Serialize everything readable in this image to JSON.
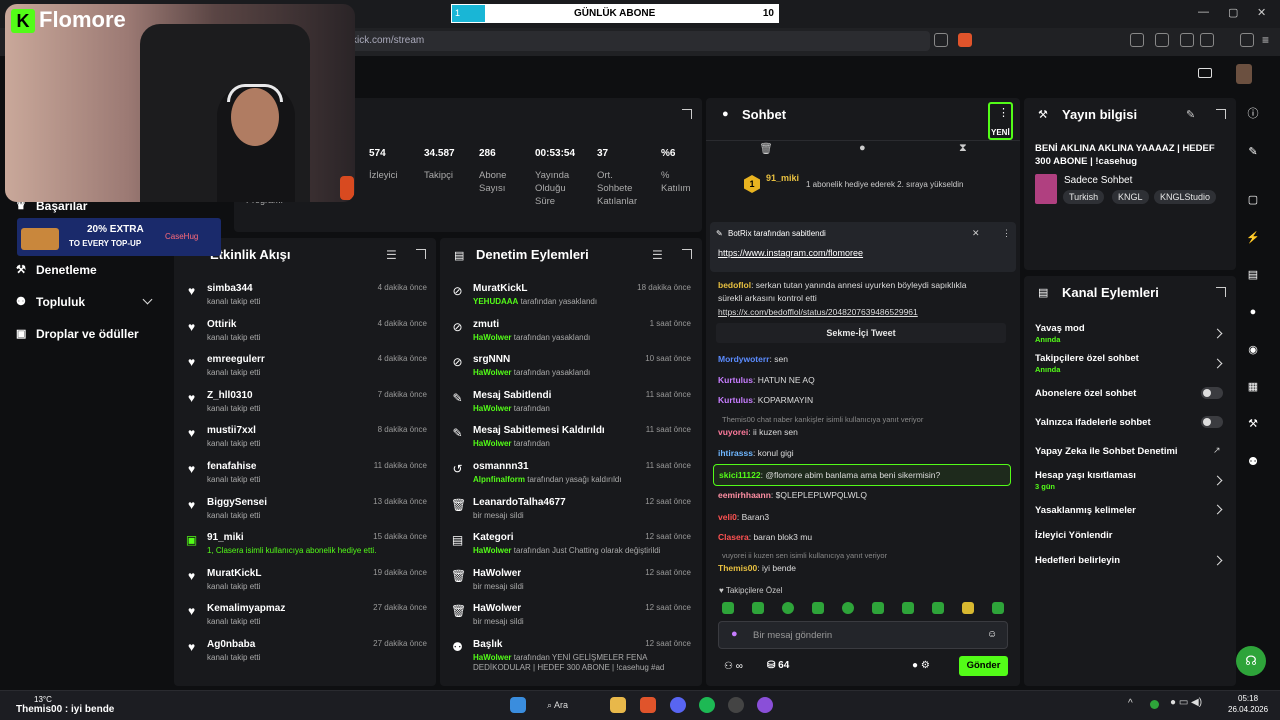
{
  "overlay": {
    "brand": "Flomore",
    "goal_label": "GÜNLÜK ABONE",
    "goal_current": "1",
    "goal_target": "10",
    "goal_progress": 0.1,
    "ad_text": "20% EXTRA",
    "ad_sub": "TO EVERY TOP-UP",
    "ad_brand": "CaseHug",
    "bottom_left": "Themis00 : iyi bende"
  },
  "browser": {
    "url": "kick.com/stream"
  },
  "sidebar": {
    "items": [
      {
        "label": "Başarılar"
      },
      {
        "label": "Denetleme"
      },
      {
        "label": "Topluluk"
      },
      {
        "label": "Droplar ve ödüller"
      }
    ],
    "partial": "Programı"
  },
  "stats": [
    {
      "value": "574",
      "label": "İzleyici"
    },
    {
      "value": "34.587",
      "label": "Takipçi"
    },
    {
      "value": "286",
      "label": "Abone Sayısı"
    },
    {
      "value": "00:53:54",
      "label": "Yayında Olduğu Süre"
    },
    {
      "value": "37",
      "label": "Ort. Sohbete Katılanlar"
    },
    {
      "value": "%6",
      "label": "% Katılım"
    }
  ],
  "activity": {
    "title": "Etkinlik Akışı",
    "items": [
      {
        "name": "simba344",
        "sub": "kanalı takip etti",
        "time": "4 dakika önce"
      },
      {
        "name": "Ottirik",
        "sub": "kanalı takip etti",
        "time": "4 dakika önce"
      },
      {
        "name": "emreegulerr",
        "sub": "kanalı takip etti",
        "time": "4 dakika önce"
      },
      {
        "name": "Z_hll0310",
        "sub": "kanalı takip etti",
        "time": "7 dakika önce"
      },
      {
        "name": "mustii7xxl",
        "sub": "kanalı takip etti",
        "time": "8 dakika önce"
      },
      {
        "name": "fenafahise",
        "sub": "kanalı takip etti",
        "time": "11 dakika önce"
      },
      {
        "name": "BiggySensei",
        "sub": "kanalı takip etti",
        "time": "13 dakika önce"
      },
      {
        "name": "91_miki",
        "sub": "1, Clasera isimli kullanıcıya abonelik hediye etti.",
        "time": "15 dakika önce"
      },
      {
        "name": "MuratKickL",
        "sub": "kanalı takip etti",
        "time": "19 dakika önce"
      },
      {
        "name": "Kemalimyapmaz",
        "sub": "kanalı takip etti",
        "time": "27 dakika önce"
      },
      {
        "name": "Ag0nbaba",
        "sub": "kanalı takip etti",
        "time": "27 dakika önce"
      }
    ]
  },
  "moderation": {
    "title": "Denetim Eylemleri",
    "items": [
      {
        "name": "MuratKickL",
        "who": "YEHUDAAA",
        "sub": "tarafından yasaklandı",
        "time": "18 dakika önce"
      },
      {
        "name": "zmuti",
        "who": "HaWolwer",
        "sub": "tarafından yasaklandı",
        "time": "1 saat önce"
      },
      {
        "name": "srgNNN",
        "who": "HaWolwer",
        "sub": "tarafından yasaklandı",
        "time": "10 saat önce"
      },
      {
        "name": "Mesaj Sabitlendi",
        "who": "HaWolwer",
        "sub": "tarafından",
        "time": "11 saat önce"
      },
      {
        "name": "Mesaj Sabitlemesi Kaldırıldı",
        "who": "HaWolwer",
        "sub": "tarafından",
        "time": "11 saat önce"
      },
      {
        "name": "osmannn31",
        "who": "Alpnfinalform",
        "sub": "tarafından yasağı kaldırıldı",
        "time": "11 saat önce"
      },
      {
        "name": "LeanardoTalha4677",
        "who": "",
        "sub": "bir mesajı sildi",
        "time": "12 saat önce"
      },
      {
        "name": "Kategori",
        "who": "HaWolwer",
        "sub": "tarafından Just Chatting olarak değiştirildi",
        "time": "12 saat önce"
      },
      {
        "name": "HaWolwer",
        "who": "",
        "sub": "bir mesajı sildi",
        "time": "12 saat önce"
      },
      {
        "name": "HaWolwer",
        "who": "",
        "sub": "bir mesajı sildi",
        "time": "12 saat önce"
      },
      {
        "name": "Başlık",
        "who": "HaWolwer",
        "sub": "tarafından YENİ GELİŞMELER FENA DEDİKODULAR | HEDEF 300 ABONE | !casehug #ad",
        "time": "12 saat önce"
      }
    ]
  },
  "chat": {
    "title": "Sohbet",
    "new_badge": "YENİ",
    "gift_user": "91_miki",
    "gift_count": "1",
    "gift_text": "1 abonelik hediye ederek 2. sıraya yükseldin",
    "pinned_by": "BotRix tarafından sabitlendi",
    "pinned_link": "https://www.instagram.com/flomoree",
    "tweet_button": "Sekme-İçi Tweet",
    "followers_only": "Takipçilere Özel",
    "placeholder": "Bir mesaj gönderin",
    "points": "64",
    "send": "Gönder"
  },
  "messages": [
    {
      "user": "bedoflol",
      "color": "#e8c040",
      "text": "serkan tutan yanında annesi uyurken böyleydi sapıklıkla"
    },
    {
      "user": "",
      "color": "#ddd",
      "text": "sürekli arkasını kontrol etti"
    },
    {
      "user": "",
      "color": "#ddd",
      "text": "https://x.com/bedofflol/status/2048207639486529961"
    },
    {
      "user": "Mordywoterr",
      "color": "#5b8cff",
      "text": "sen"
    },
    {
      "user": "Kurtulus",
      "color": "#c77dff",
      "text": "HATUN NE AQ"
    },
    {
      "user": "Kurtulus",
      "color": "#c77dff",
      "text": "KOPARMAYIN"
    },
    {
      "user": "Themis00",
      "color": "#888",
      "text": "chat naber kankişler isimli kullanıcıya yanıt veriyor"
    },
    {
      "user": "vuyorei",
      "color": "#ff7a9c",
      "text": "ii kuzen sen"
    },
    {
      "user": "ihtirasss",
      "color": "#6fb7ff",
      "text": "konul gigi"
    },
    {
      "user": "skici11122",
      "color": "#53fc18",
      "text": "@flomore abim banlama ama beni sikermisin?"
    },
    {
      "user": "eemirhhaann",
      "color": "#ff8fa3",
      "text": "$QLEPLEPLWPQLWLQ"
    },
    {
      "user": "veli0",
      "color": "#ff5252",
      "text": "Baran3"
    },
    {
      "user": "Clasera",
      "color": "#ff5252",
      "text": "baran blok3 mu"
    },
    {
      "user": "vuyorei",
      "color": "#888",
      "text": "ii kuzen sen isimli kullanıcıya yanıt veriyor"
    },
    {
      "user": "Themis00",
      "color": "#e8c040",
      "text": "iyi bende"
    }
  ],
  "stream_info": {
    "title": "Yayın bilgisi",
    "stream_title": "BENİ AKLINA AKLINA YAAAAZ | HEDEF 300 ABONE | !casehug",
    "category": "Sadece Sohbet",
    "tags": [
      "Turkish",
      "KNGL",
      "KNGLStudio"
    ]
  },
  "channel_actions": {
    "title": "Kanal Eylemleri",
    "items": [
      {
        "label": "Yavaş mod",
        "sub": "Anında"
      },
      {
        "label": "Takipçilere özel sohbet",
        "sub": "Anında"
      },
      {
        "label": "Abonelere özel sohbet",
        "sub": ""
      },
      {
        "label": "Yalnızca ifadelerle sohbet",
        "sub": ""
      },
      {
        "label": "Yapay Zeka ile Sohbet Denetimi",
        "sub": ""
      },
      {
        "label": "Hesap yaşı kısıtlaması",
        "sub": "3 gün"
      },
      {
        "label": "Yasaklanmış kelimeler",
        "sub": ""
      },
      {
        "label": "İzleyici Yönlendir",
        "sub": ""
      },
      {
        "label": "Hedefleri belirleyin",
        "sub": ""
      }
    ]
  },
  "taskbar": {
    "weather": "13°C",
    "search": "Ara",
    "time": "05:18",
    "date": "26.04.2026"
  }
}
